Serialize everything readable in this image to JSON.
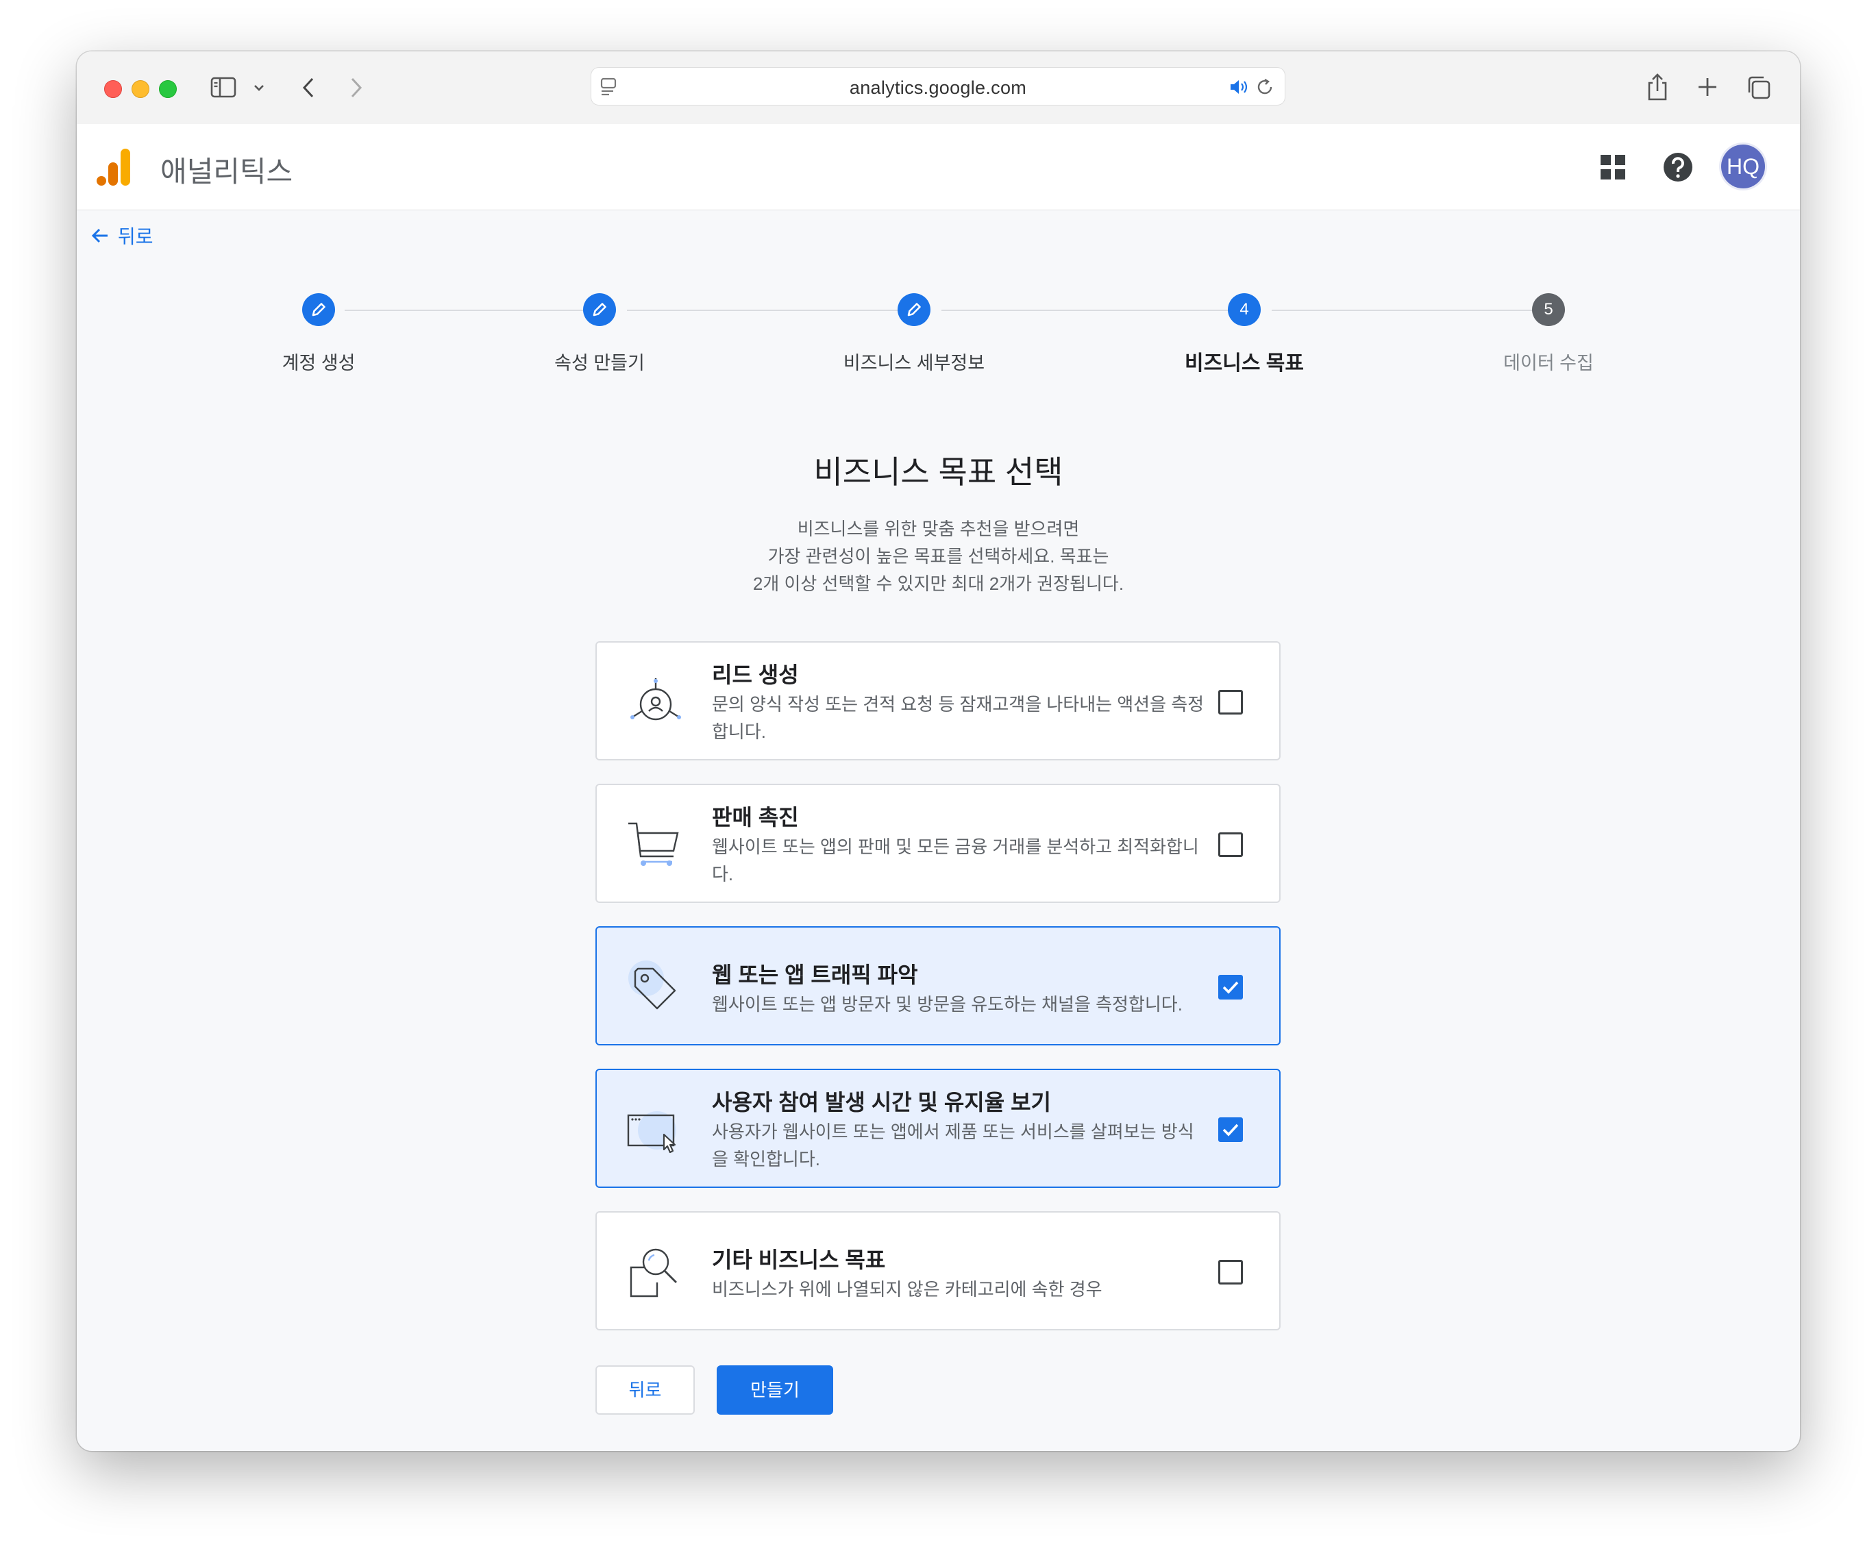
{
  "browser": {
    "url": "analytics.google.com"
  },
  "app": {
    "title": "애널리틱스",
    "avatar_initials": "HQ",
    "back_link": "뒤로"
  },
  "stepper": {
    "steps": [
      {
        "label": "계정 생성",
        "status": "done",
        "marker": ""
      },
      {
        "label": "속성 만들기",
        "status": "done",
        "marker": ""
      },
      {
        "label": "비즈니스 세부정보",
        "status": "done",
        "marker": ""
      },
      {
        "label": "비즈니스 목표",
        "status": "active",
        "marker": "4"
      },
      {
        "label": "데이터 수집",
        "status": "pending",
        "marker": "5"
      }
    ]
  },
  "main": {
    "heading": "비즈니스 목표 선택",
    "description": [
      "비즈니스를 위한 맞춤 추천을 받으려면",
      "가장 관련성이 높은 목표를 선택하세요. 목표는",
      "2개 이상 선택할 수 있지만 최대 2개가 권장됩니다."
    ],
    "options": [
      {
        "title": "리드 생성",
        "description": "문의 양식 작성 또는 견적 요청 등 잠재고객을 나타내는 액션을 측정합니다.",
        "checked": false,
        "icon": "lead-network-icon"
      },
      {
        "title": "판매 촉진",
        "description": "웹사이트 또는 앱의 판매 및 모든 금융 거래를 분석하고 최적화합니다.",
        "checked": false,
        "icon": "shopping-cart-icon"
      },
      {
        "title": "웹 또는 앱 트래픽 파악",
        "description": "웹사이트 또는 앱 방문자 및 방문을 유도하는 채널을 측정합니다.",
        "checked": true,
        "icon": "tag-icon"
      },
      {
        "title": "사용자 참여 발생 시간 및 유지율 보기",
        "description": "사용자가 웹사이트 또는 앱에서 제품 또는 서비스를 살펴보는 방식을 확인합니다.",
        "checked": true,
        "icon": "window-cursor-icon"
      },
      {
        "title": "기타 비즈니스 목표",
        "description": "비즈니스가 위에 나열되지 않은 카테고리에 속한 경우",
        "checked": false,
        "icon": "magnifier-icon"
      }
    ],
    "back_button": "뒤로",
    "create_button": "만들기"
  }
}
